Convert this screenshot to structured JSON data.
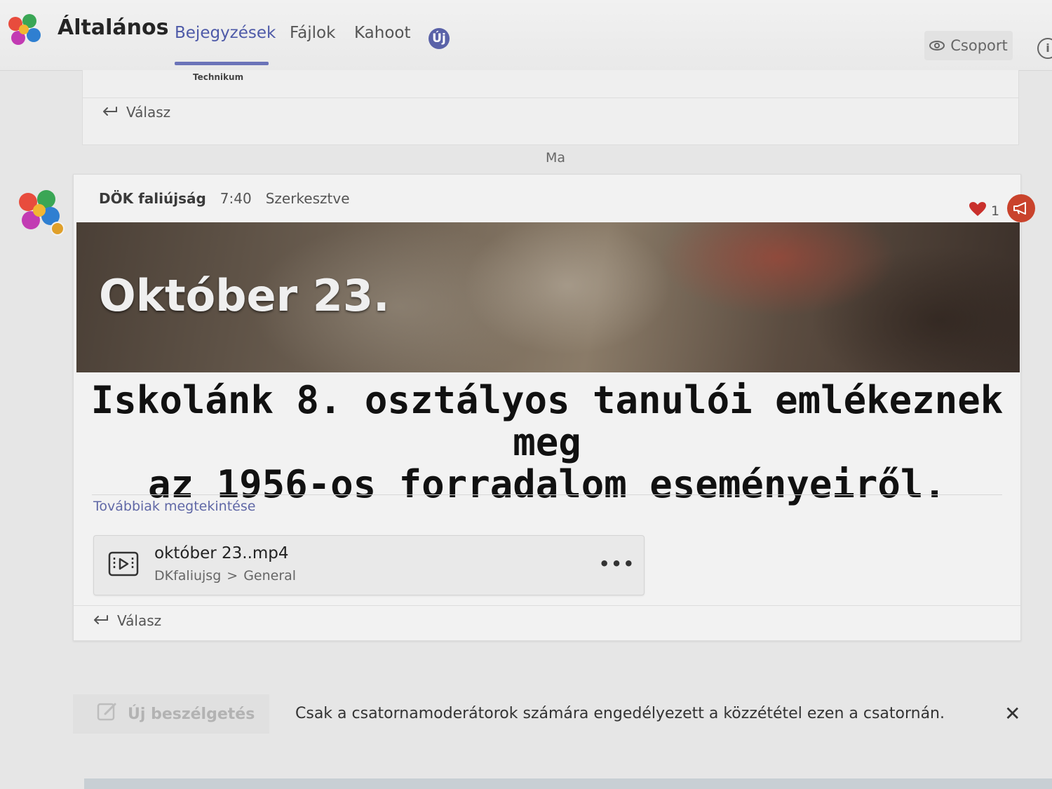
{
  "header": {
    "channel_name": "Általános",
    "tabs": [
      {
        "label": "Bejegyzések",
        "active": true
      },
      {
        "label": "Fájlok",
        "active": false
      },
      {
        "label": "Kahoot",
        "active": false
      }
    ],
    "new_badge": "Új",
    "group_button": "Csoport",
    "accent_color": "#5a62a8"
  },
  "previous_post": {
    "caption": "Technikum",
    "reply_label": "Válasz"
  },
  "day_divider": "Ma",
  "post": {
    "author": "DÖK faliújság",
    "time": "7:40",
    "edited": "Szerkesztve",
    "reaction_count": "1",
    "banner_title": "Október 23.",
    "headline_line1": "Iskolánk 8. osztályos tanulói emlékeznek meg",
    "headline_line2": "az 1956-os forradalom eseményeiről.",
    "see_more": "Továbbiak megtekintése",
    "attachment": {
      "file_name": "október 23..mp4",
      "path_team": "DKfaliujsg",
      "path_channel": "General",
      "path_separator": ">"
    },
    "reply_label": "Válasz"
  },
  "compose": {
    "new_conversation": "Új beszélgetés",
    "moderation_note": "Csak a csatornamoderátorok számára engedélyezett a közzététel ezen a csatornán.",
    "close_symbol": "✕"
  },
  "icons": [
    "team-logo-icon",
    "eye-icon",
    "info-icon",
    "reply-icon",
    "heart-icon",
    "megaphone-icon",
    "video-file-icon",
    "more-options-icon",
    "compose-icon",
    "close-icon"
  ]
}
